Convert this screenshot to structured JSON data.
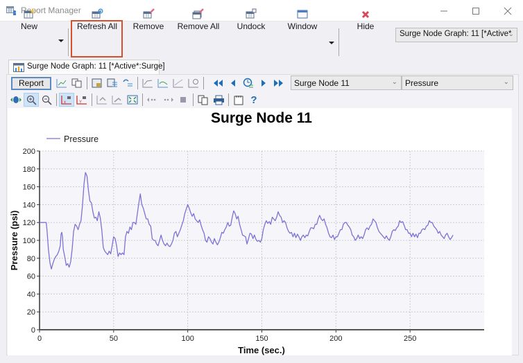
{
  "window": {
    "title": "Report Manager",
    "controls": [
      "minimize",
      "maximize",
      "close"
    ]
  },
  "ribbon": {
    "buttons": [
      {
        "id": "new",
        "label": "New",
        "icon": "new-report-icon",
        "has_dropdown": true
      },
      {
        "id": "refresh_all",
        "label": "Refresh All",
        "icon": "refresh-report-icon",
        "highlighted": true
      },
      {
        "id": "remove",
        "label": "Remove",
        "icon": "remove-report-icon"
      },
      {
        "id": "remove_all",
        "label": "Remove All",
        "icon": "remove-all-reports-icon"
      },
      {
        "id": "undock",
        "label": "Undock",
        "icon": "undock-icon"
      },
      {
        "id": "window",
        "label": "Window",
        "icon": "window-icon",
        "has_dropdown": true
      },
      {
        "id": "hide",
        "label": "Hide",
        "icon": "close-x-icon"
      }
    ],
    "graph_selector": {
      "value": "Surge Node Graph: 11 [*Active*"
    },
    "highlight_color": "#d5502b"
  },
  "document_tab": {
    "label": "Surge Node Graph: 11 [*Active*:Surge]"
  },
  "graph_toolbar": {
    "report_button": "Report",
    "node_combo": {
      "value": "Surge Node 11"
    },
    "variable_combo": {
      "value": "Pressure"
    }
  },
  "chart_data": {
    "type": "line",
    "title": "Surge Node 11",
    "xlabel": "Time (sec.)",
    "ylabel": "Pressure (psi)",
    "xlim": [
      0,
      300
    ],
    "ylim": [
      0,
      200
    ],
    "x_ticks": [
      "0",
      "50",
      "100",
      "150",
      "200",
      "250"
    ],
    "x_tick_values": [
      0,
      50,
      100,
      150,
      200,
      250
    ],
    "y_ticks": [
      "0",
      "20",
      "40",
      "60",
      "80",
      "100",
      "120",
      "140",
      "160",
      "180",
      "200"
    ],
    "y_tick_values": [
      0,
      20,
      40,
      60,
      80,
      100,
      120,
      140,
      160,
      180,
      200
    ],
    "grid": true,
    "legend": {
      "position": "top-left",
      "entries": [
        "Pressure"
      ]
    },
    "series": [
      {
        "name": "Pressure",
        "color": "#7b72d4",
        "points": [
          [
            0,
            120
          ],
          [
            4.5,
            120
          ],
          [
            5,
            112
          ],
          [
            6,
            90
          ],
          [
            7,
            75
          ],
          [
            8,
            68
          ],
          [
            9,
            74
          ],
          [
            10,
            79
          ],
          [
            11,
            82
          ],
          [
            12,
            84
          ],
          [
            13,
            88
          ],
          [
            14,
            94
          ],
          [
            14.5,
            107
          ],
          [
            15,
            109
          ],
          [
            15.5,
            104
          ],
          [
            16,
            90
          ],
          [
            17,
            82
          ],
          [
            18,
            72
          ],
          [
            19,
            74
          ],
          [
            20,
            70
          ],
          [
            21,
            76
          ],
          [
            22,
            90
          ],
          [
            23,
            110
          ],
          [
            24,
            118
          ],
          [
            25,
            116
          ],
          [
            26,
            112
          ],
          [
            27,
            118
          ],
          [
            28,
            122
          ],
          [
            29,
            140
          ],
          [
            30,
            163
          ],
          [
            31,
            176
          ],
          [
            32,
            172
          ],
          [
            33,
            156
          ],
          [
            34,
            144
          ],
          [
            35,
            142
          ],
          [
            36,
            132
          ],
          [
            37,
            125
          ],
          [
            38,
            126
          ],
          [
            39,
            122
          ],
          [
            40,
            132
          ],
          [
            41,
            125
          ],
          [
            42,
            112
          ],
          [
            43,
            92
          ],
          [
            44,
            88
          ],
          [
            45,
            86
          ],
          [
            46,
            84
          ],
          [
            47,
            88
          ],
          [
            48,
            85
          ],
          [
            49,
            94
          ],
          [
            50,
            104
          ],
          [
            51,
            102
          ],
          [
            52,
            94
          ],
          [
            53,
            82
          ],
          [
            54,
            86
          ],
          [
            55,
            84
          ],
          [
            56,
            86
          ],
          [
            57,
            84
          ],
          [
            58,
            104
          ],
          [
            59,
            110
          ],
          [
            60,
            108
          ],
          [
            61,
            115
          ],
          [
            62,
            112
          ],
          [
            63,
            120
          ],
          [
            64,
            120
          ],
          [
            65,
            118
          ],
          [
            66,
            130
          ],
          [
            67,
            142
          ],
          [
            68,
            152
          ],
          [
            69,
            140
          ],
          [
            70,
            136
          ],
          [
            71,
            130
          ],
          [
            72,
            124
          ],
          [
            73,
            124
          ],
          [
            74,
            118
          ],
          [
            75,
            116
          ],
          [
            76,
            102
          ],
          [
            77,
            100
          ],
          [
            78,
            100
          ],
          [
            79,
            96
          ],
          [
            80,
            94
          ],
          [
            81,
            100
          ],
          [
            82,
            106
          ],
          [
            83,
            100
          ],
          [
            84,
            96
          ],
          [
            85,
            94
          ],
          [
            86,
            97
          ],
          [
            87,
            94
          ],
          [
            88,
            93
          ],
          [
            89,
            96
          ],
          [
            90,
            100
          ],
          [
            91,
            108
          ],
          [
            92,
            110
          ],
          [
            93,
            104
          ],
          [
            94,
            108
          ],
          [
            95,
            112
          ],
          [
            96,
            117
          ],
          [
            97,
            122
          ],
          [
            98,
            130
          ],
          [
            99,
            135
          ],
          [
            100,
            140
          ],
          [
            101,
            136
          ],
          [
            102,
            131
          ],
          [
            103,
            127
          ],
          [
            104,
            130
          ],
          [
            105,
            124
          ],
          [
            106,
            122
          ],
          [
            107,
            120
          ],
          [
            108,
            123
          ],
          [
            109,
            117
          ],
          [
            110,
            112
          ],
          [
            111,
            108
          ],
          [
            112,
            100
          ],
          [
            113,
            98
          ],
          [
            114,
            104
          ],
          [
            115,
            102
          ],
          [
            116,
            98
          ],
          [
            117,
            96
          ],
          [
            118,
            102
          ],
          [
            119,
            98
          ],
          [
            120,
            95
          ],
          [
            121,
            98
          ],
          [
            122,
            103
          ],
          [
            123,
            109
          ],
          [
            124,
            108
          ],
          [
            125,
            112
          ],
          [
            126,
            115
          ],
          [
            127,
            120
          ],
          [
            128,
            116
          ],
          [
            129,
            117
          ],
          [
            130,
            126
          ],
          [
            131,
            133
          ],
          [
            132,
            130
          ],
          [
            133,
            124
          ],
          [
            134,
            127
          ],
          [
            135,
            118
          ],
          [
            136,
            112
          ],
          [
            137,
            106
          ],
          [
            138,
            105
          ],
          [
            139,
            104
          ],
          [
            140,
            96
          ],
          [
            141,
            102
          ],
          [
            142,
            108
          ],
          [
            143,
            107
          ],
          [
            144,
            102
          ],
          [
            145,
            106
          ],
          [
            146,
            101
          ],
          [
            147,
            99
          ],
          [
            148,
            100
          ],
          [
            149,
            98
          ],
          [
            150,
            102
          ],
          [
            151,
            112
          ],
          [
            152,
            118
          ],
          [
            153,
            122
          ],
          [
            154,
            119
          ],
          [
            155,
            121
          ],
          [
            156,
            118
          ],
          [
            157,
            126
          ],
          [
            158,
            124
          ],
          [
            159,
            122
          ],
          [
            160,
            126
          ],
          [
            161,
            132
          ],
          [
            162,
            128
          ],
          [
            163,
            126
          ],
          [
            164,
            120
          ],
          [
            165,
            122
          ],
          [
            166,
            120
          ],
          [
            167,
            114
          ],
          [
            168,
            110
          ],
          [
            169,
            108
          ],
          [
            170,
            109
          ],
          [
            171,
            104
          ],
          [
            172,
            108
          ],
          [
            173,
            103
          ],
          [
            174,
            107
          ],
          [
            175,
            104
          ],
          [
            176,
            100
          ],
          [
            177,
            104
          ],
          [
            178,
            106
          ],
          [
            179,
            103
          ],
          [
            180,
            106
          ],
          [
            181,
            105
          ],
          [
            182,
            110
          ],
          [
            183,
            114
          ],
          [
            184,
            114
          ],
          [
            185,
            113
          ],
          [
            186,
            118
          ],
          [
            187,
            118
          ],
          [
            188,
            124
          ],
          [
            189,
            128
          ],
          [
            190,
            124
          ],
          [
            191,
            122
          ],
          [
            192,
            124
          ],
          [
            193,
            118
          ],
          [
            194,
            114
          ],
          [
            195,
            108
          ],
          [
            196,
            104
          ],
          [
            197,
            103
          ],
          [
            198,
            106
          ],
          [
            199,
            101
          ],
          [
            200,
            104
          ],
          [
            201,
            104
          ],
          [
            202,
            108
          ],
          [
            203,
            112
          ],
          [
            204,
            112
          ],
          [
            205,
            118
          ],
          [
            206,
            120
          ],
          [
            207,
            120
          ],
          [
            208,
            117
          ],
          [
            209,
            115
          ],
          [
            210,
            112
          ],
          [
            211,
            106
          ],
          [
            212,
            104
          ],
          [
            213,
            100
          ],
          [
            214,
            102
          ],
          [
            215,
            106
          ],
          [
            216,
            102
          ],
          [
            217,
            104
          ],
          [
            218,
            102
          ],
          [
            219,
            106
          ],
          [
            220,
            112
          ],
          [
            221,
            114
          ],
          [
            222,
            112
          ],
          [
            223,
            116
          ],
          [
            224,
            118
          ],
          [
            225,
            124
          ],
          [
            226,
            122
          ],
          [
            227,
            120
          ],
          [
            228,
            114
          ],
          [
            229,
            110
          ],
          [
            230,
            108
          ],
          [
            231,
            106
          ],
          [
            232,
            104
          ],
          [
            233,
            102
          ],
          [
            234,
            105
          ],
          [
            235,
            102
          ],
          [
            236,
            100
          ],
          [
            237,
            104
          ],
          [
            238,
            110
          ],
          [
            239,
            112
          ],
          [
            240,
            111
          ],
          [
            241,
            114
          ],
          [
            242,
            116
          ],
          [
            243,
            122
          ],
          [
            244,
            120
          ],
          [
            245,
            121
          ],
          [
            246,
            117
          ],
          [
            247,
            112
          ],
          [
            248,
            112
          ],
          [
            249,
            108
          ],
          [
            250,
            108
          ],
          [
            251,
            104
          ],
          [
            252,
            108
          ],
          [
            253,
            104
          ],
          [
            254,
            107
          ],
          [
            255,
            103
          ],
          [
            256,
            108
          ],
          [
            257,
            108
          ],
          [
            258,
            112
          ],
          [
            259,
            113
          ],
          [
            260,
            112
          ],
          [
            261,
            116
          ],
          [
            262,
            117
          ],
          [
            263,
            122
          ],
          [
            264,
            120
          ],
          [
            265,
            120
          ],
          [
            266,
            116
          ],
          [
            267,
            114
          ],
          [
            268,
            112
          ],
          [
            269,
            108
          ],
          [
            270,
            110
          ],
          [
            271,
            106
          ],
          [
            272,
            104
          ],
          [
            273,
            102
          ],
          [
            274,
            106
          ],
          [
            275,
            108
          ],
          [
            276,
            104
          ],
          [
            277,
            101
          ],
          [
            278,
            103
          ],
          [
            279,
            106
          ]
        ]
      }
    ]
  }
}
